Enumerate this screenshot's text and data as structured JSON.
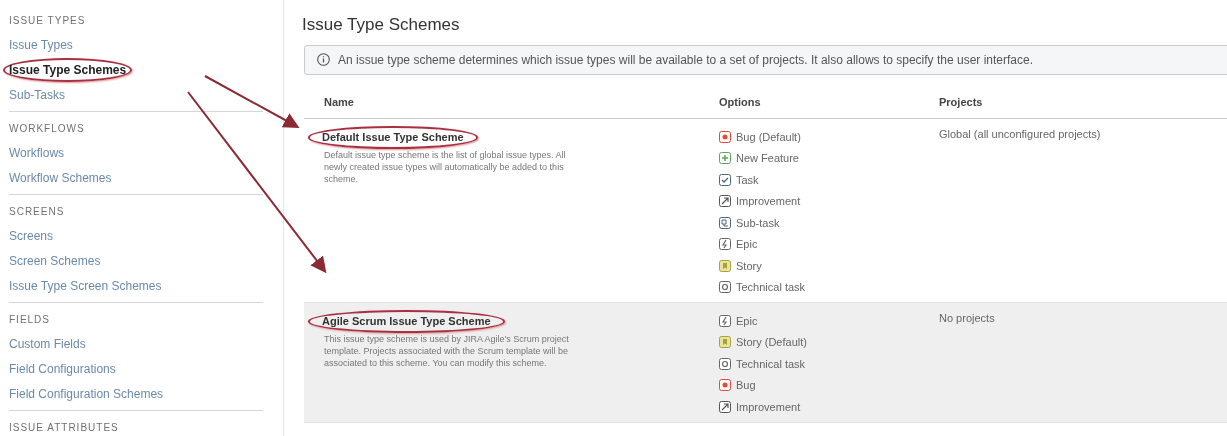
{
  "sidebar": {
    "sections": [
      {
        "heading": "ISSUE TYPES",
        "items": [
          {
            "label": "Issue Types",
            "selected": false,
            "highlighted": false
          },
          {
            "label": "Issue Type Schemes",
            "selected": true,
            "highlighted": true
          },
          {
            "label": "Sub-Tasks",
            "selected": false,
            "highlighted": false
          }
        ]
      },
      {
        "heading": "WORKFLOWS",
        "items": [
          {
            "label": "Workflows",
            "selected": false,
            "highlighted": false
          },
          {
            "label": "Workflow Schemes",
            "selected": false,
            "highlighted": false
          }
        ]
      },
      {
        "heading": "SCREENS",
        "items": [
          {
            "label": "Screens",
            "selected": false,
            "highlighted": false
          },
          {
            "label": "Screen Schemes",
            "selected": false,
            "highlighted": false
          },
          {
            "label": "Issue Type Screen Schemes",
            "selected": false,
            "highlighted": false
          }
        ]
      },
      {
        "heading": "FIELDS",
        "items": [
          {
            "label": "Custom Fields",
            "selected": false,
            "highlighted": false
          },
          {
            "label": "Field Configurations",
            "selected": false,
            "highlighted": false
          },
          {
            "label": "Field Configuration Schemes",
            "selected": false,
            "highlighted": false
          }
        ]
      },
      {
        "heading": "ISSUE ATTRIBUTES"
      }
    ]
  },
  "page": {
    "title": "Issue Type Schemes",
    "info": "An issue type scheme determines which issue types will be available to a set of projects. It also allows to specify the user interface.",
    "table": {
      "columns": [
        "Name",
        "Options",
        "Projects"
      ],
      "rows": [
        {
          "name": "Default Issue Type Scheme",
          "highlighted": true,
          "description": "Default issue type scheme is the list of global issue types. All newly created issue types will automatically be added to this scheme.",
          "projects": "Global (all unconfigured projects)",
          "options": [
            {
              "kind": "bug",
              "label": "Bug (Default)"
            },
            {
              "kind": "feature",
              "label": "New Feature"
            },
            {
              "kind": "task",
              "label": "Task"
            },
            {
              "kind": "improvement",
              "label": "Improvement"
            },
            {
              "kind": "subtask",
              "label": "Sub-task"
            },
            {
              "kind": "epic",
              "label": "Epic"
            },
            {
              "kind": "story",
              "label": "Story"
            },
            {
              "kind": "technical",
              "label": "Technical task"
            }
          ]
        },
        {
          "name": "Agile Scrum Issue Type Scheme",
          "highlighted": true,
          "description": "This issue type scheme is used by JIRA Agile's Scrum project template. Projects associated with the Scrum template will be associated to this scheme. You can modify this scheme.",
          "projects": "No projects",
          "options": [
            {
              "kind": "epic",
              "label": "Epic"
            },
            {
              "kind": "story",
              "label": "Story (Default)"
            },
            {
              "kind": "technical",
              "label": "Technical task"
            },
            {
              "kind": "bug",
              "label": "Bug"
            },
            {
              "kind": "improvement",
              "label": "Improvement"
            }
          ]
        }
      ]
    }
  }
}
